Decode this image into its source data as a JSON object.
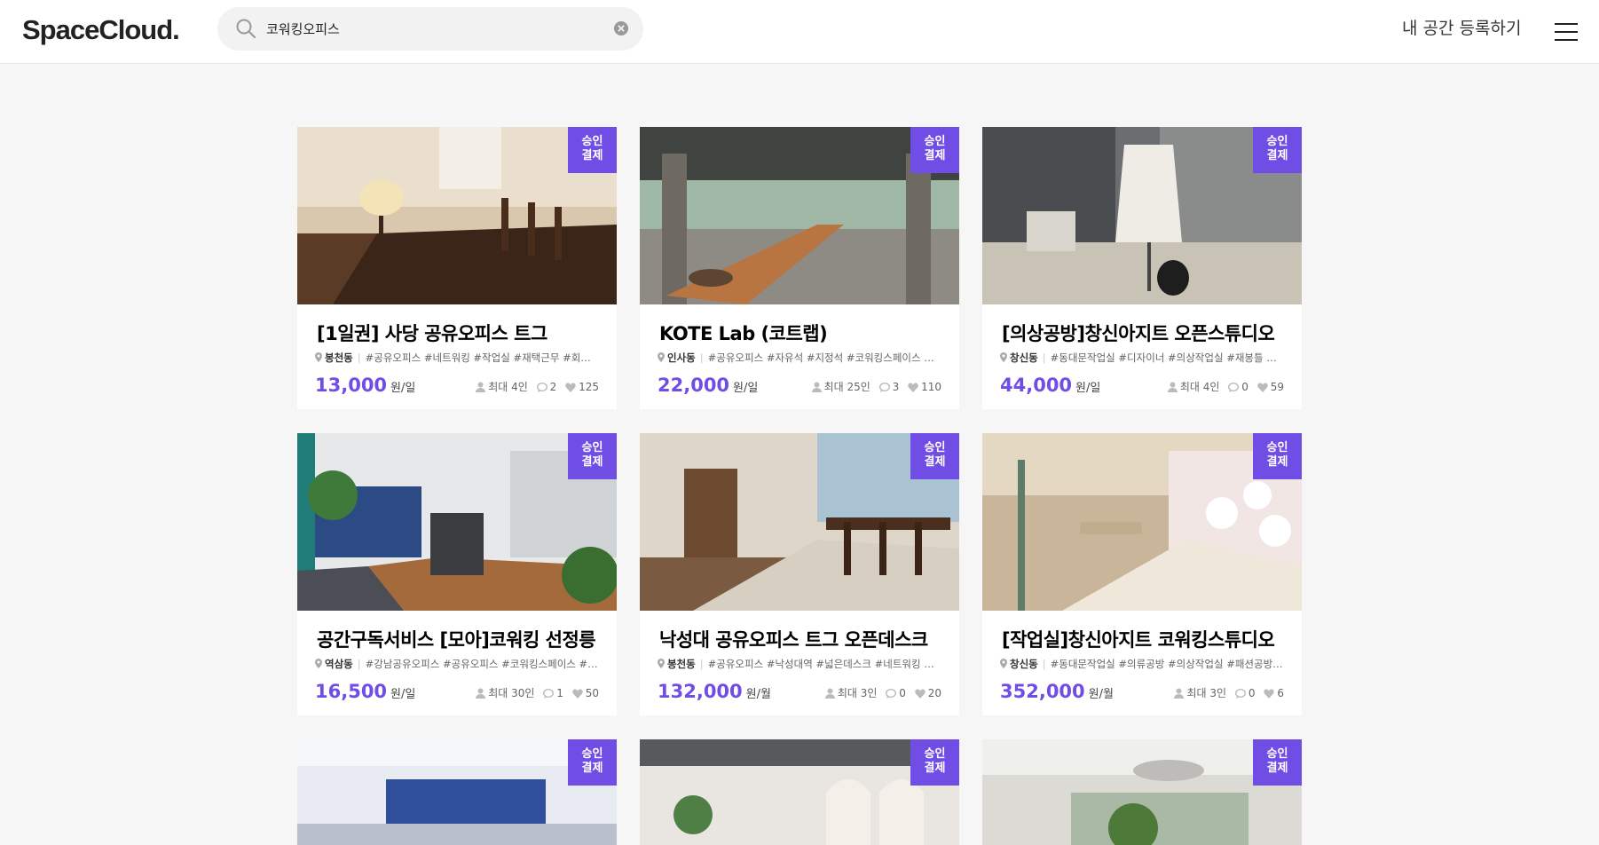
{
  "header": {
    "logo": "SpaceCloud.",
    "search_value": "코워킹오피스",
    "register_label": "내 공간 등록하기"
  },
  "badge_line1": "승인",
  "badge_line2": "결제",
  "cards": [
    {
      "title": "[1일권] 사당 공유오피스 트그",
      "location": "봉천동",
      "tags": "#공유오피스 #네트워킹 #작업실 #재택근무 #회의실",
      "price": "13,000",
      "unit": "원/일",
      "capacity": "최대 4인",
      "comments": "2",
      "likes": "125"
    },
    {
      "title": "KOTE Lab (코트랩)",
      "location": "인사동",
      "tags": "#공유오피스 #자유석 #지정석 #코워킹스페이스 #인사동",
      "price": "22,000",
      "unit": "원/일",
      "capacity": "최대 25인",
      "comments": "3",
      "likes": "110"
    },
    {
      "title": "[의상공방]창신아지트 오픈스튜디오",
      "location": "창신동",
      "tags": "#동대문작업실 #디자이너 #의상작업실 #재봉틀 #패턴",
      "price": "44,000",
      "unit": "원/일",
      "capacity": "최대 4인",
      "comments": "0",
      "likes": "59"
    },
    {
      "title": "공간구독서비스 [모아]코워킹 선정릉",
      "location": "역삼동",
      "tags": "#강남공유오피스 #공유오피스 #코워킹스페이스 #선정릉",
      "price": "16,500",
      "unit": "원/일",
      "capacity": "최대 30인",
      "comments": "1",
      "likes": "50"
    },
    {
      "title": "낙성대 공유오피스 트그 오픈데스크",
      "location": "봉천동",
      "tags": "#공유오피스 #낙성대역 #넓은데스크 #네트워킹 #작업실",
      "price": "132,000",
      "unit": "원/월",
      "capacity": "최대 3인",
      "comments": "0",
      "likes": "20"
    },
    {
      "title": "[작업실]창신아지트 코워킹스튜디오",
      "location": "창신동",
      "tags": "#동대문작업실 #의류공방 #의상작업실 #패션공방 #재봉틀",
      "price": "352,000",
      "unit": "원/월",
      "capacity": "최대 3인",
      "comments": "0",
      "likes": "6"
    }
  ]
}
